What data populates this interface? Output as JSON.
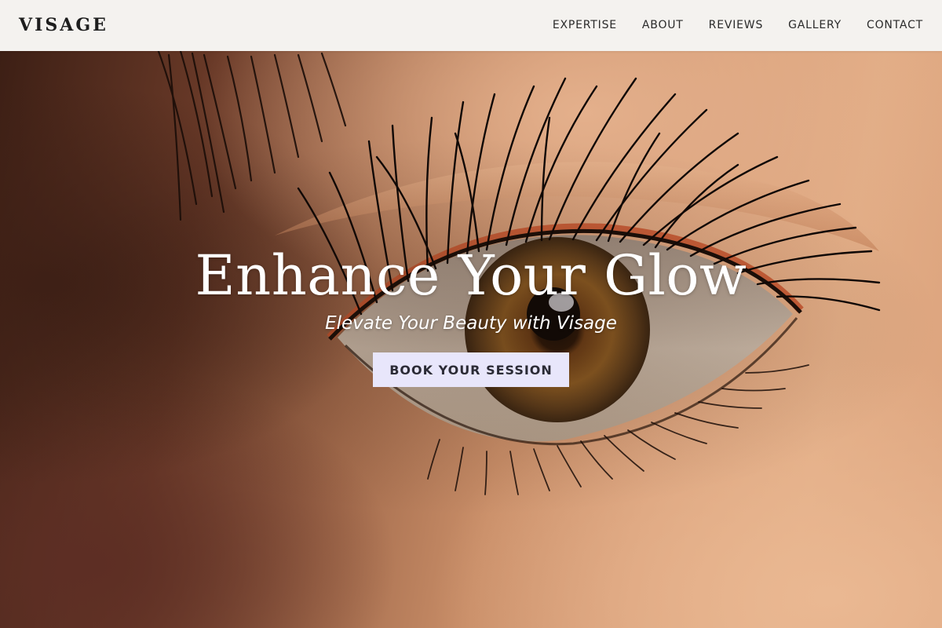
{
  "header": {
    "logo": "VISAGE",
    "nav": [
      {
        "label": "EXPERTISE"
      },
      {
        "label": "ABOUT"
      },
      {
        "label": "REVIEWS"
      },
      {
        "label": "GALLERY"
      },
      {
        "label": "CONTACT"
      }
    ]
  },
  "hero": {
    "title": "Enhance Your Glow",
    "subtitle": "Elevate Your Beauty with Visage",
    "cta_label": "BOOK YOUR SESSION",
    "background_image": "close-up-eye-photo"
  },
  "colors": {
    "header_bg": "#f4f2ef",
    "logo": "#1d1d1d",
    "cta_bg": "#e8e6fb",
    "cta_text": "#2b2b36",
    "hero_text": "#ffffff"
  }
}
